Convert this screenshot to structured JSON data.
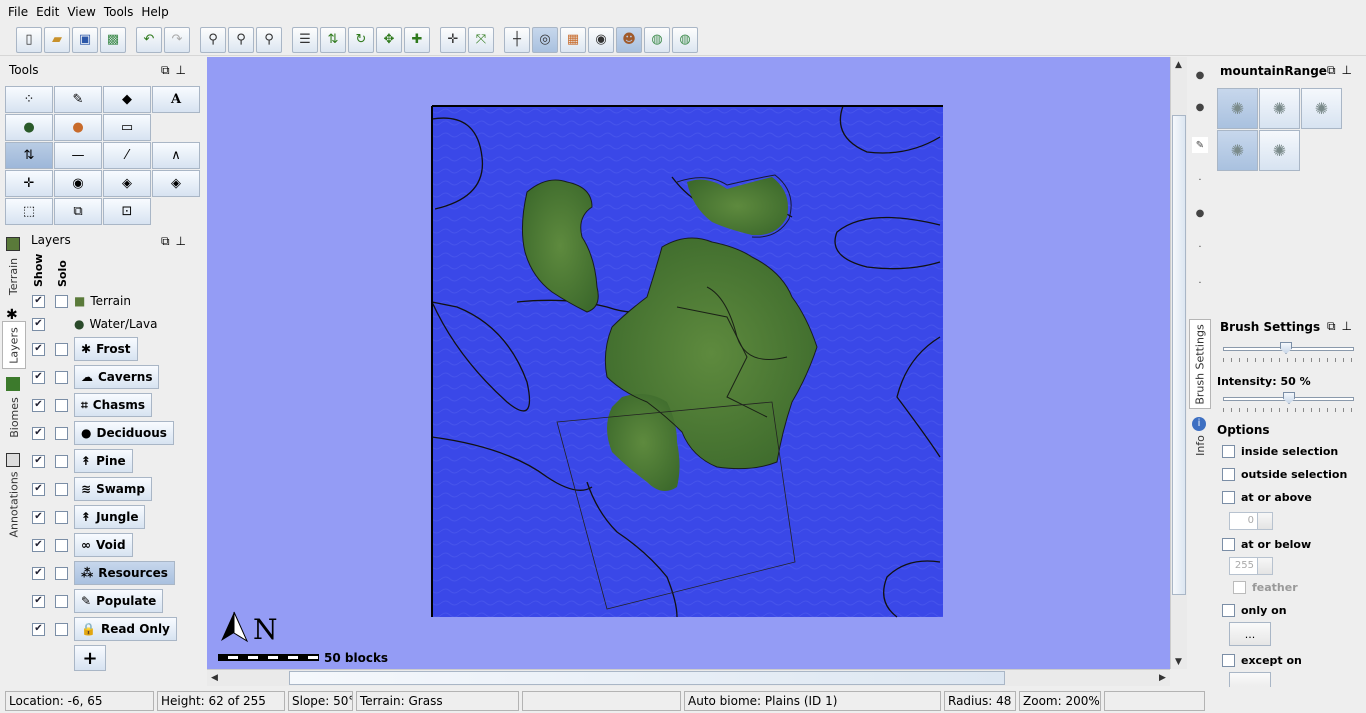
{
  "menu": [
    "File",
    "Edit",
    "View",
    "Tools",
    "Help"
  ],
  "toolbar_icons": [
    "new-icon",
    "open-icon",
    "save-icon",
    "export-icon",
    "undo-icon",
    "redo-icon",
    "zoom-out-icon",
    "zoom-reset-icon",
    "zoom-in-icon",
    "dimension-properties-icon",
    "height-icon",
    "rotate-icon",
    "shift-icon",
    "add-tiles-icon",
    "center-icon",
    "fit-view-icon",
    "grid-icon",
    "contours-icon",
    "image-overlay-icon",
    "view-icon",
    "user-icon",
    "merge-icon",
    "export-world-icon"
  ],
  "tools": {
    "title": "Tools",
    "rows": [
      [
        "spray-paint-icon",
        "pencil-icon",
        "fill-icon",
        "text-icon"
      ],
      [
        "flood-water-icon",
        "flood-lava-icon",
        "sponge-icon"
      ],
      [
        "raise-lower-icon",
        "flatten-icon",
        "smooth-icon",
        "raise-mountain-icon"
      ],
      [
        "raise-pyramid-icon",
        "globe-icon",
        "dome-icon",
        "rotated-dome-icon"
      ],
      [
        "selection-icon",
        "copy-selection-icon",
        "clear-selection-icon"
      ]
    ],
    "symbols": [
      [
        "⁘",
        "✎",
        "◆",
        "A"
      ],
      [
        "●",
        "●",
        "▭"
      ],
      [
        "⇅",
        "—",
        "⁄",
        "∧"
      ],
      [
        "✛",
        "◉",
        "◈",
        "◈"
      ],
      [
        "⬚",
        "⧉",
        "⊡"
      ]
    ],
    "selected": "raise-lower-icon"
  },
  "side_tabs": [
    "Terrain",
    "Layers",
    "Biomes",
    "Annotations"
  ],
  "layers": {
    "title": "Layers",
    "show_header": "Show",
    "solo_header": "Solo",
    "items": [
      {
        "name": "Terrain",
        "show": true,
        "solo": false,
        "icon": "■",
        "color": "#5a7a3a",
        "button": false
      },
      {
        "name": "Water/Lava",
        "show": true,
        "solo": null,
        "icon": "●",
        "color": "#2a4a2a",
        "button": false
      },
      {
        "name": "Frost",
        "show": true,
        "solo": false,
        "icon": "✱",
        "button": true
      },
      {
        "name": "Caverns",
        "show": true,
        "solo": false,
        "icon": "☁",
        "button": true
      },
      {
        "name": "Chasms",
        "show": true,
        "solo": false,
        "icon": "⌗",
        "button": true
      },
      {
        "name": "Deciduous",
        "show": true,
        "solo": false,
        "icon": "●",
        "button": true
      },
      {
        "name": "Pine",
        "show": true,
        "solo": false,
        "icon": "↟",
        "button": true
      },
      {
        "name": "Swamp",
        "show": true,
        "solo": false,
        "icon": "≋",
        "button": true
      },
      {
        "name": "Jungle",
        "show": true,
        "solo": false,
        "icon": "↟",
        "button": true
      },
      {
        "name": "Void",
        "show": true,
        "solo": false,
        "icon": "∞",
        "button": true
      },
      {
        "name": "Resources",
        "show": true,
        "solo": false,
        "icon": "⁂",
        "button": true,
        "selected": true
      },
      {
        "name": "Populate",
        "show": true,
        "solo": false,
        "icon": "✎",
        "button": true
      },
      {
        "name": "Read Only",
        "show": true,
        "solo": false,
        "icon": "🔒",
        "button": true
      }
    ],
    "add_label": "+"
  },
  "map": {
    "compass_letter": "N",
    "scale_label": "50 blocks"
  },
  "brush": {
    "title": "mountainRange",
    "cells": 5,
    "selected": 0
  },
  "settings": {
    "title": "Brush Settings",
    "radius_slider_value": 0.48,
    "intensity_label": "Intensity: 50 %",
    "intensity_value": 0.5,
    "options_label": "Options",
    "inside_selection": "inside selection",
    "outside_selection": "outside selection",
    "at_or_above": "at or above",
    "at_or_above_value": "0",
    "at_or_below": "at or below",
    "at_or_below_value": "255",
    "feather": "feather",
    "only_on": "only on",
    "only_on_button": "...",
    "except_on": "except on"
  },
  "right_tabs": [
    "Brush Settings",
    "Info"
  ],
  "status": {
    "location": "Location: -6, 65",
    "height": "Height: 62 of 255",
    "slope": "Slope: 50°",
    "terrain": "Terrain: Grass",
    "empty1": "",
    "biome": "Auto biome: Plains (ID 1)",
    "radius": "Radius: 48",
    "zoom": "Zoom: 200%"
  },
  "colors": {
    "ocean": "#3a48e8",
    "void": "#949cf5",
    "land": "#4f7a3a"
  }
}
